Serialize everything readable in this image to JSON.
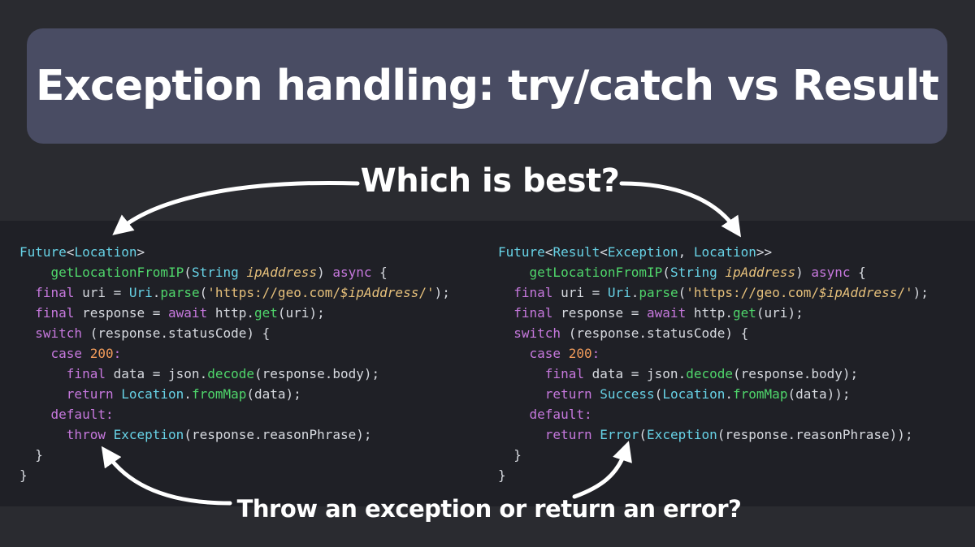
{
  "title": "Exception handling: try/catch vs Result",
  "question": "Which is best?",
  "bottom_caption": "Throw an exception or return an error?",
  "left_code": [
    [
      [
        "t",
        "Future"
      ],
      [
        "p",
        "<"
      ],
      [
        "t",
        "Location"
      ],
      [
        "p",
        ">"
      ]
    ],
    [
      [
        "p",
        "    "
      ],
      [
        "f",
        "getLocationFromIP"
      ],
      [
        "p",
        "("
      ],
      [
        "t",
        "String"
      ],
      [
        "p",
        " "
      ],
      [
        "i",
        "ipAddress"
      ],
      [
        "p",
        ") "
      ],
      [
        "k",
        "async"
      ],
      [
        "p",
        " {"
      ]
    ],
    [
      [
        "p",
        "  "
      ],
      [
        "k",
        "final"
      ],
      [
        "p",
        " uri = "
      ],
      [
        "t",
        "Uri"
      ],
      [
        "p",
        "."
      ],
      [
        "f",
        "parse"
      ],
      [
        "p",
        "("
      ],
      [
        "s",
        "'https://geo.com/"
      ],
      [
        "i",
        "$ipAddress"
      ],
      [
        "s",
        "/'"
      ],
      [
        "p",
        ");"
      ]
    ],
    [
      [
        "p",
        "  "
      ],
      [
        "k",
        "final"
      ],
      [
        "p",
        " response = "
      ],
      [
        "k",
        "await"
      ],
      [
        "p",
        " http."
      ],
      [
        "f",
        "get"
      ],
      [
        "p",
        "(uri);"
      ]
    ],
    [
      [
        "p",
        "  "
      ],
      [
        "k",
        "switch"
      ],
      [
        "p",
        " (response.statusCode) {"
      ]
    ],
    [
      [
        "p",
        "    "
      ],
      [
        "k",
        "case"
      ],
      [
        "p",
        " "
      ],
      [
        "n",
        "200"
      ],
      [
        "k",
        ":"
      ]
    ],
    [
      [
        "p",
        "      "
      ],
      [
        "k",
        "final"
      ],
      [
        "p",
        " data = json."
      ],
      [
        "f",
        "decode"
      ],
      [
        "p",
        "(response.body);"
      ]
    ],
    [
      [
        "p",
        "      "
      ],
      [
        "k",
        "return"
      ],
      [
        "p",
        " "
      ],
      [
        "t",
        "Location"
      ],
      [
        "p",
        "."
      ],
      [
        "f",
        "fromMap"
      ],
      [
        "p",
        "(data);"
      ]
    ],
    [
      [
        "p",
        "    "
      ],
      [
        "k",
        "default:"
      ]
    ],
    [
      [
        "p",
        "      "
      ],
      [
        "k",
        "throw"
      ],
      [
        "p",
        " "
      ],
      [
        "t",
        "Exception"
      ],
      [
        "p",
        "(response.reasonPhrase);"
      ]
    ],
    [
      [
        "p",
        "  }"
      ]
    ],
    [
      [
        "p",
        "}"
      ]
    ]
  ],
  "right_code": [
    [
      [
        "t",
        "Future"
      ],
      [
        "p",
        "<"
      ],
      [
        "t",
        "Result"
      ],
      [
        "p",
        "<"
      ],
      [
        "t",
        "Exception"
      ],
      [
        "p",
        ", "
      ],
      [
        "t",
        "Location"
      ],
      [
        "p",
        ">>"
      ]
    ],
    [
      [
        "p",
        "    "
      ],
      [
        "f",
        "getLocationFromIP"
      ],
      [
        "p",
        "("
      ],
      [
        "t",
        "String"
      ],
      [
        "p",
        " "
      ],
      [
        "i",
        "ipAddress"
      ],
      [
        "p",
        ") "
      ],
      [
        "k",
        "async"
      ],
      [
        "p",
        " {"
      ]
    ],
    [
      [
        "p",
        "  "
      ],
      [
        "k",
        "final"
      ],
      [
        "p",
        " uri = "
      ],
      [
        "t",
        "Uri"
      ],
      [
        "p",
        "."
      ],
      [
        "f",
        "parse"
      ],
      [
        "p",
        "("
      ],
      [
        "s",
        "'https://geo.com/"
      ],
      [
        "i",
        "$ipAddress"
      ],
      [
        "s",
        "/'"
      ],
      [
        "p",
        ");"
      ]
    ],
    [
      [
        "p",
        "  "
      ],
      [
        "k",
        "final"
      ],
      [
        "p",
        " response = "
      ],
      [
        "k",
        "await"
      ],
      [
        "p",
        " http."
      ],
      [
        "f",
        "get"
      ],
      [
        "p",
        "(uri);"
      ]
    ],
    [
      [
        "p",
        "  "
      ],
      [
        "k",
        "switch"
      ],
      [
        "p",
        " (response.statusCode) {"
      ]
    ],
    [
      [
        "p",
        "    "
      ],
      [
        "k",
        "case"
      ],
      [
        "p",
        " "
      ],
      [
        "n",
        "200"
      ],
      [
        "k",
        ":"
      ]
    ],
    [
      [
        "p",
        "      "
      ],
      [
        "k",
        "final"
      ],
      [
        "p",
        " data = json."
      ],
      [
        "f",
        "decode"
      ],
      [
        "p",
        "(response.body);"
      ]
    ],
    [
      [
        "p",
        "      "
      ],
      [
        "k",
        "return"
      ],
      [
        "p",
        " "
      ],
      [
        "t",
        "Success"
      ],
      [
        "p",
        "("
      ],
      [
        "t",
        "Location"
      ],
      [
        "p",
        "."
      ],
      [
        "f",
        "fromMap"
      ],
      [
        "p",
        "(data));"
      ]
    ],
    [
      [
        "p",
        "    "
      ],
      [
        "k",
        "default:"
      ]
    ],
    [
      [
        "p",
        "      "
      ],
      [
        "k",
        "return"
      ],
      [
        "p",
        " "
      ],
      [
        "t",
        "Error"
      ],
      [
        "p",
        "("
      ],
      [
        "t",
        "Exception"
      ],
      [
        "p",
        "(response.reasonPhrase));"
      ]
    ],
    [
      [
        "p",
        "  }"
      ]
    ],
    [
      [
        "p",
        "}"
      ]
    ]
  ],
  "colors": {
    "background": "#2a2b30",
    "banner": "#494c63",
    "code_background": "#1f2026",
    "keyword": "#c678dd",
    "type": "#67d2e6",
    "function": "#4fd66b",
    "string": "#e6c07b",
    "number": "#ef9a5a"
  }
}
